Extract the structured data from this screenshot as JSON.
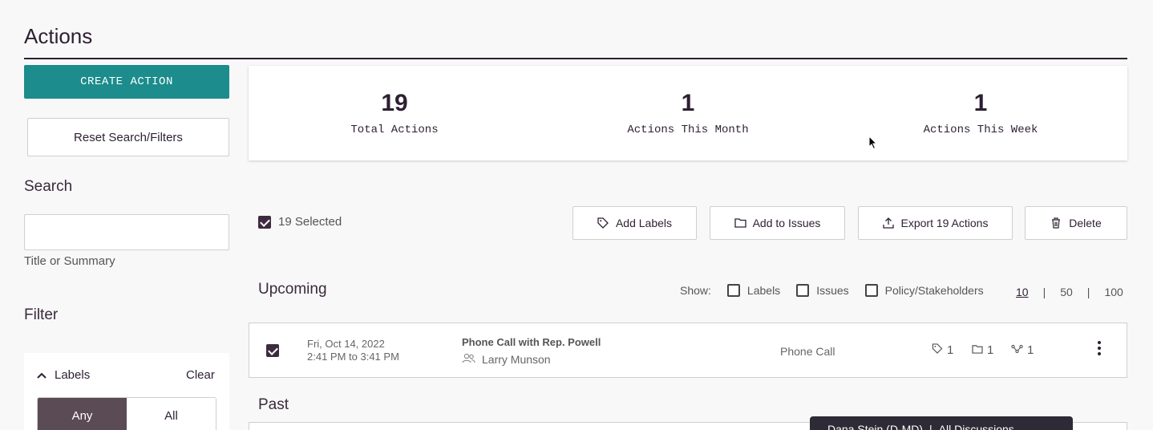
{
  "page": {
    "title": "Actions"
  },
  "sidebar": {
    "create_label": "CREATE ACTION",
    "reset_label": "Reset Search/Filters",
    "search_heading": "Search",
    "search_help": "Title or Summary",
    "filter_heading": "Filter",
    "labels_filter": {
      "heading": "Labels",
      "clear": "Clear",
      "any": "Any",
      "all": "All",
      "selected": "Any"
    }
  },
  "stats": [
    {
      "value": "19",
      "label": "Total Actions"
    },
    {
      "value": "1",
      "label": "Actions This Month"
    },
    {
      "value": "1",
      "label": "Actions This Week"
    }
  ],
  "bulk": {
    "selected_text": "19 Selected",
    "add_labels": "Add Labels",
    "add_to_issues": "Add to Issues",
    "export": "Export 19 Actions",
    "delete": "Delete"
  },
  "upcoming": {
    "heading": "Upcoming",
    "show_label": "Show:",
    "show_options": [
      "Labels",
      "Issues",
      "Policy/Stakeholders"
    ],
    "page_sizes": [
      "10",
      "50",
      "100"
    ],
    "current_page_size": "10",
    "rows": [
      {
        "date": "Fri, Oct 14, 2022",
        "time": "2:41 PM to 3:41 PM",
        "title": "Phone Call with Rep. Powell",
        "person": "Larry Munson",
        "type": "Phone Call",
        "labels_count": "1",
        "issues_count": "1",
        "stakeholders_count": "1"
      }
    ]
  },
  "past": {
    "heading": "Past"
  },
  "toast": {
    "left": "Dana Stein (D-MD)",
    "right": "All Discussions"
  },
  "colors": {
    "accent": "#1c8c8c",
    "ink": "#2e1f33",
    "segment_active": "#5b4b55"
  }
}
